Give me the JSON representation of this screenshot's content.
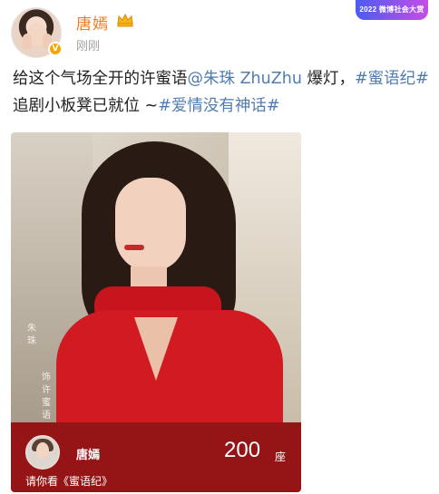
{
  "header": {
    "username": "唐嫣",
    "timestamp": "刚刚",
    "event_badge": "2022 微博社会大赏",
    "crown_icon": "crown-icon",
    "verify_icon": "verified-v-icon"
  },
  "post": {
    "text_1": "给这个气场全开的许蜜语",
    "mention": "@朱珠 ZhuZhu",
    "text_2": " 爆灯，",
    "hashtag_1": "#蜜语纪#",
    "text_3": " 追剧小板凳已就位 ~",
    "hashtag_2": "#爱情没有神话#"
  },
  "card": {
    "caption_left": "朱珠",
    "caption_right": "饰许蜜语",
    "footer_name": "唐嫣",
    "count": "200",
    "count_unit": "座",
    "invite": "请你看《蜜语纪》"
  },
  "colors": {
    "username": "#f47b20",
    "link": "#507daf",
    "footer_bg": "#951516"
  }
}
